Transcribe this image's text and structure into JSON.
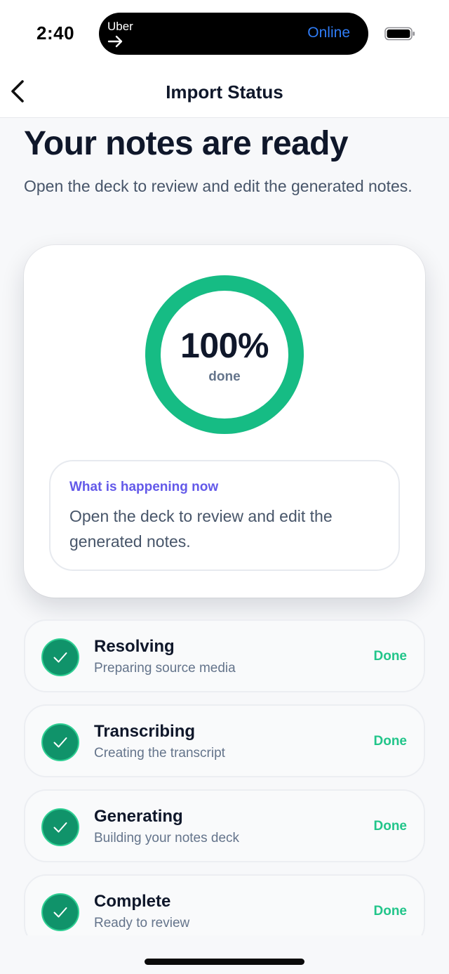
{
  "status_bar": {
    "time": "2:40",
    "live_activity": {
      "app": "Uber",
      "status": "Online"
    }
  },
  "nav": {
    "title": "Import Status",
    "back_icon": "chevron-left-icon"
  },
  "page": {
    "headline": "Your notes are ready",
    "subheadline": "Open the deck to review and edit the generated notes."
  },
  "progress": {
    "value_text": "100%",
    "label": "done",
    "fraction": 1.0,
    "ring_color": "#16bc84"
  },
  "activity": {
    "title": "What is happening now",
    "body": "Open the deck to review and edit the generated notes."
  },
  "steps": [
    {
      "title": "Resolving",
      "description": "Preparing source media",
      "state": "Done",
      "icon": "check-circle-icon"
    },
    {
      "title": "Transcribing",
      "description": "Creating the transcript",
      "state": "Done",
      "icon": "check-circle-icon"
    },
    {
      "title": "Generating",
      "description": "Building your notes deck",
      "state": "Done",
      "icon": "check-circle-icon"
    },
    {
      "title": "Complete",
      "description": "Ready to review",
      "state": "Done",
      "icon": "check-circle-icon"
    }
  ],
  "colors": {
    "accent_green": "#16bc84",
    "done_text": "#22c58a",
    "check_fill": "#10936a",
    "activity_title": "#6359e9",
    "live_status": "#2f7cf6"
  }
}
